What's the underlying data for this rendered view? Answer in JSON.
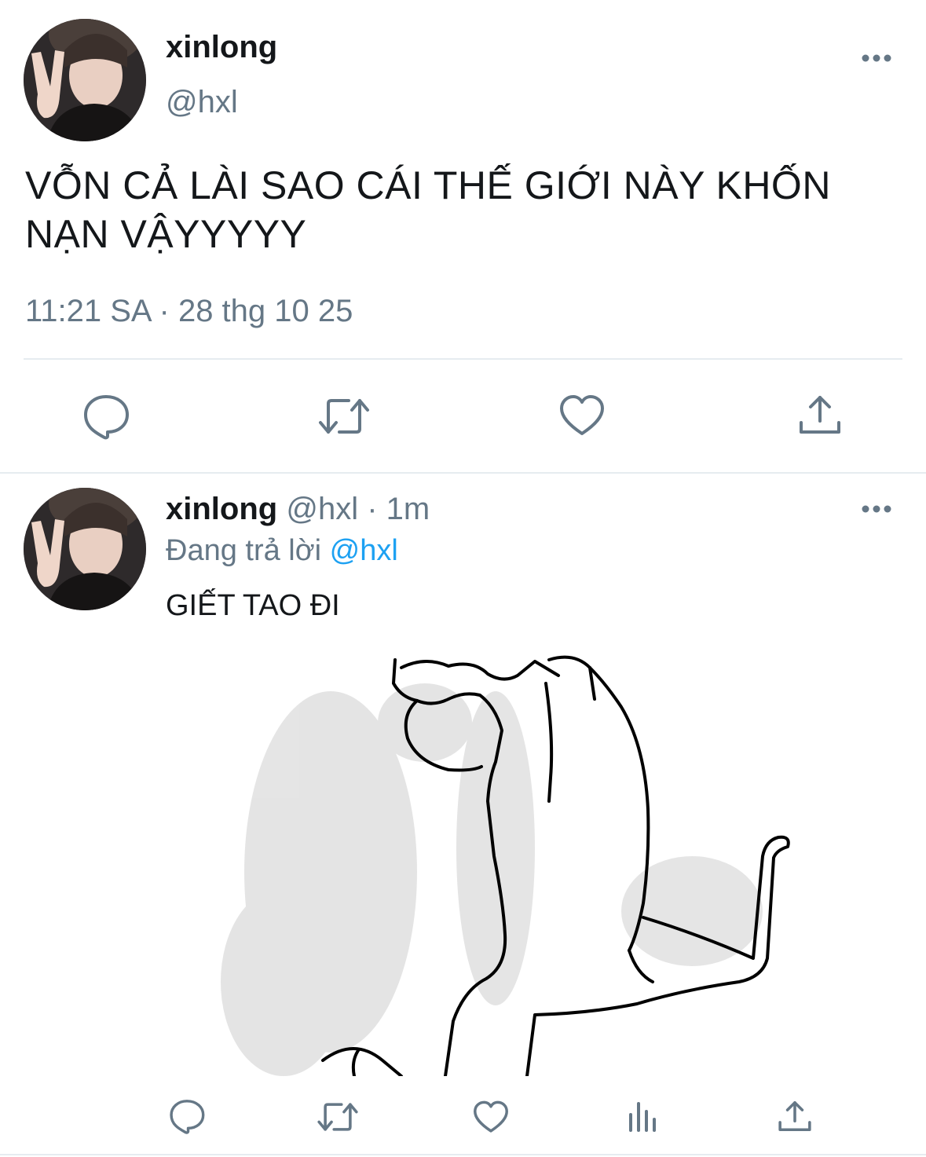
{
  "main_tweet": {
    "display_name": "xinlong",
    "handle": "@hxl",
    "text_line1": "VỖN CẢ LÀI SAO CÁI THẾ GIỚI NÀY KHỐN",
    "text_line2": "NẠN VẬYYYYY",
    "timestamp": "11:21 SA · 28 thg 10 25",
    "actions": [
      "reply-icon",
      "retweet-icon",
      "like-icon",
      "share-icon"
    ]
  },
  "reply_tweet": {
    "display_name": "xinlong",
    "handle": "@hxl",
    "separator": "·",
    "age": "1m",
    "replying_prefix": "Đang trả lời",
    "replying_to": "@hxl",
    "text": "GIẾT TAO ĐI",
    "actions": [
      "reply-icon",
      "retweet-icon",
      "like-icon",
      "analytics-icon",
      "share-icon"
    ]
  },
  "colors": {
    "text": "#14171a",
    "muted": "#657786",
    "link": "#1da1f2",
    "divider": "#e6ecf0"
  }
}
